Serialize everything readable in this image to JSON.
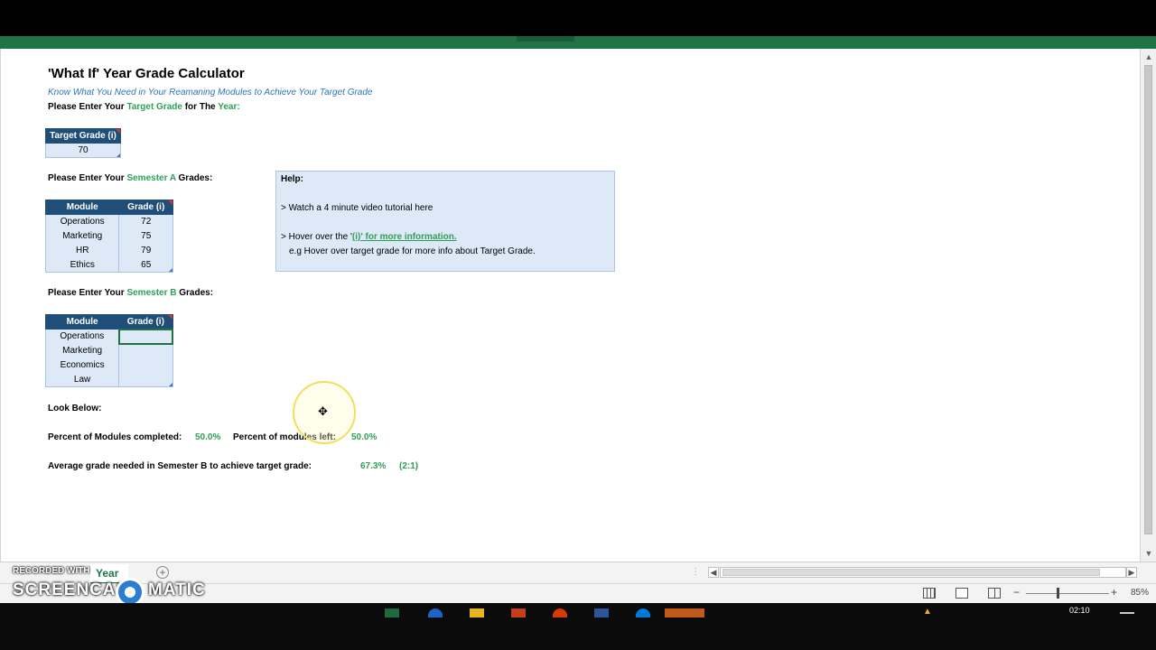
{
  "sheet": {
    "title": "'What If' Year Grade Calculator",
    "subtitle": "Know What You Need in Your Reamaning Modules to Achieve Your Target Grade",
    "target_prompt": {
      "a": "Please Enter Your ",
      "b": "Target Grade",
      "c": " for The ",
      "d": "Year:"
    },
    "target_table": {
      "header": "Target Grade (i)",
      "value": "70"
    },
    "semA_prompt": {
      "a": "Please Enter Your ",
      "b": "Semester A",
      "c": " Grades:"
    },
    "semA_table": {
      "headers": [
        "Module",
        "Grade (i)"
      ],
      "rows": [
        [
          "Operations",
          "72"
        ],
        [
          "Marketing",
          "75"
        ],
        [
          "HR",
          "79"
        ],
        [
          "Ethics",
          "65"
        ]
      ]
    },
    "semB_prompt": {
      "a": "Please Enter Your ",
      "b": "Semester B",
      "c": " Grades:"
    },
    "semB_table": {
      "headers": [
        "Module",
        "Grade (i)"
      ],
      "rows": [
        [
          "Operations",
          ""
        ],
        [
          "Marketing",
          ""
        ],
        [
          "Economics",
          ""
        ],
        [
          "Law",
          ""
        ]
      ]
    },
    "help": {
      "title": "Help:",
      "line1": "> Watch a 4 minute video tutorial here",
      "line2_pre": "> Hover over the '",
      "line2_link": "(i)' for more information.",
      "line3": "e.g Hover over target grade for more info about Target Grade."
    },
    "look_below": "Look Below:",
    "pct_completed_label": "Percent of Modules completed:",
    "pct_completed_value": "50.0%",
    "pct_left_label": "Percent of modules left:",
    "pct_left_value": "50.0%",
    "avg_needed_label": "Average grade needed in Semester B to achieve target grade:",
    "avg_needed_value": "67.3%",
    "avg_needed_class": "(2:1)"
  },
  "tabbar": {
    "sheet_tab": "Year",
    "watermark_top": "RECORDED WITH",
    "watermark_main": "SCREENCAST",
    "watermark_tail": "MATIC"
  },
  "status": {
    "zoom": "85%",
    "minus": "−",
    "plus": "+"
  },
  "taskbar": {
    "clock": "02:10"
  },
  "colors": {
    "accent": "#217346",
    "header_blue": "#1f4e79",
    "value_green": "#2fa05a",
    "cell_fill": "#dde9f6"
  }
}
